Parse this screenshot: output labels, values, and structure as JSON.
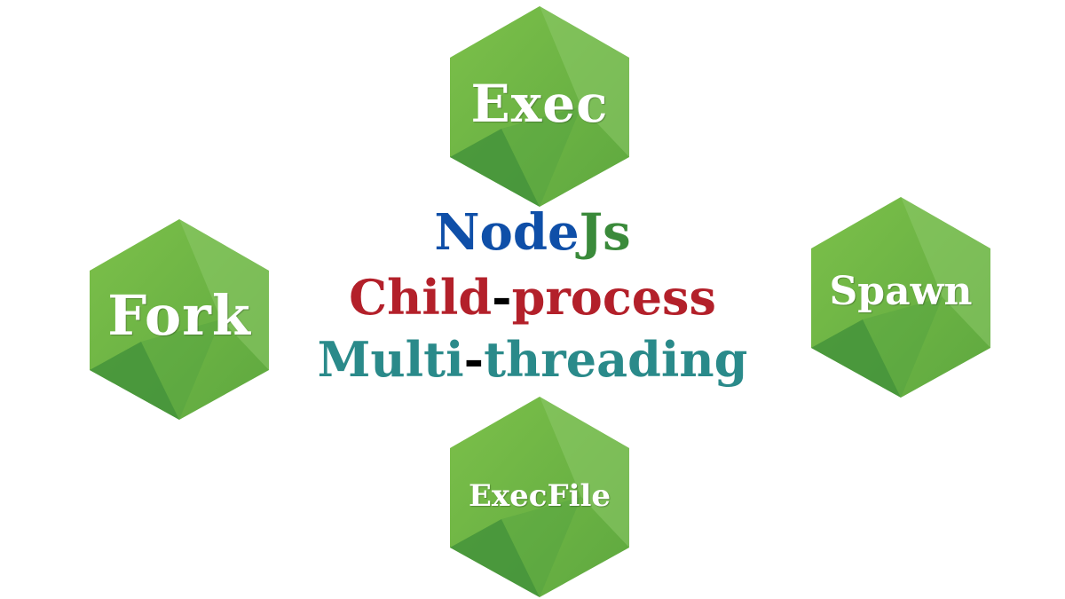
{
  "colors": {
    "hex_light": "#8cc84b",
    "hex_mid": "#6aac42",
    "hex_dark": "#3d8b37",
    "node_blue": "#0f4fa8",
    "js_green": "#3a8a3a",
    "child_red": "#b3202a",
    "multi_teal": "#2a8a8a",
    "hyphen_black": "#000000"
  },
  "hexagons": {
    "exec": {
      "label": "Exec"
    },
    "fork": {
      "label": "Fork"
    },
    "spawn": {
      "label": "Spawn"
    },
    "execfile": {
      "label": "ExecFile"
    }
  },
  "center": {
    "line1": {
      "part1": "Node",
      "part2": "Js"
    },
    "line2": {
      "part1": "Child",
      "hyphen": "-",
      "part2": "process"
    },
    "line3": {
      "part1": "Multi",
      "hyphen": "-",
      "part2": "threading"
    }
  }
}
